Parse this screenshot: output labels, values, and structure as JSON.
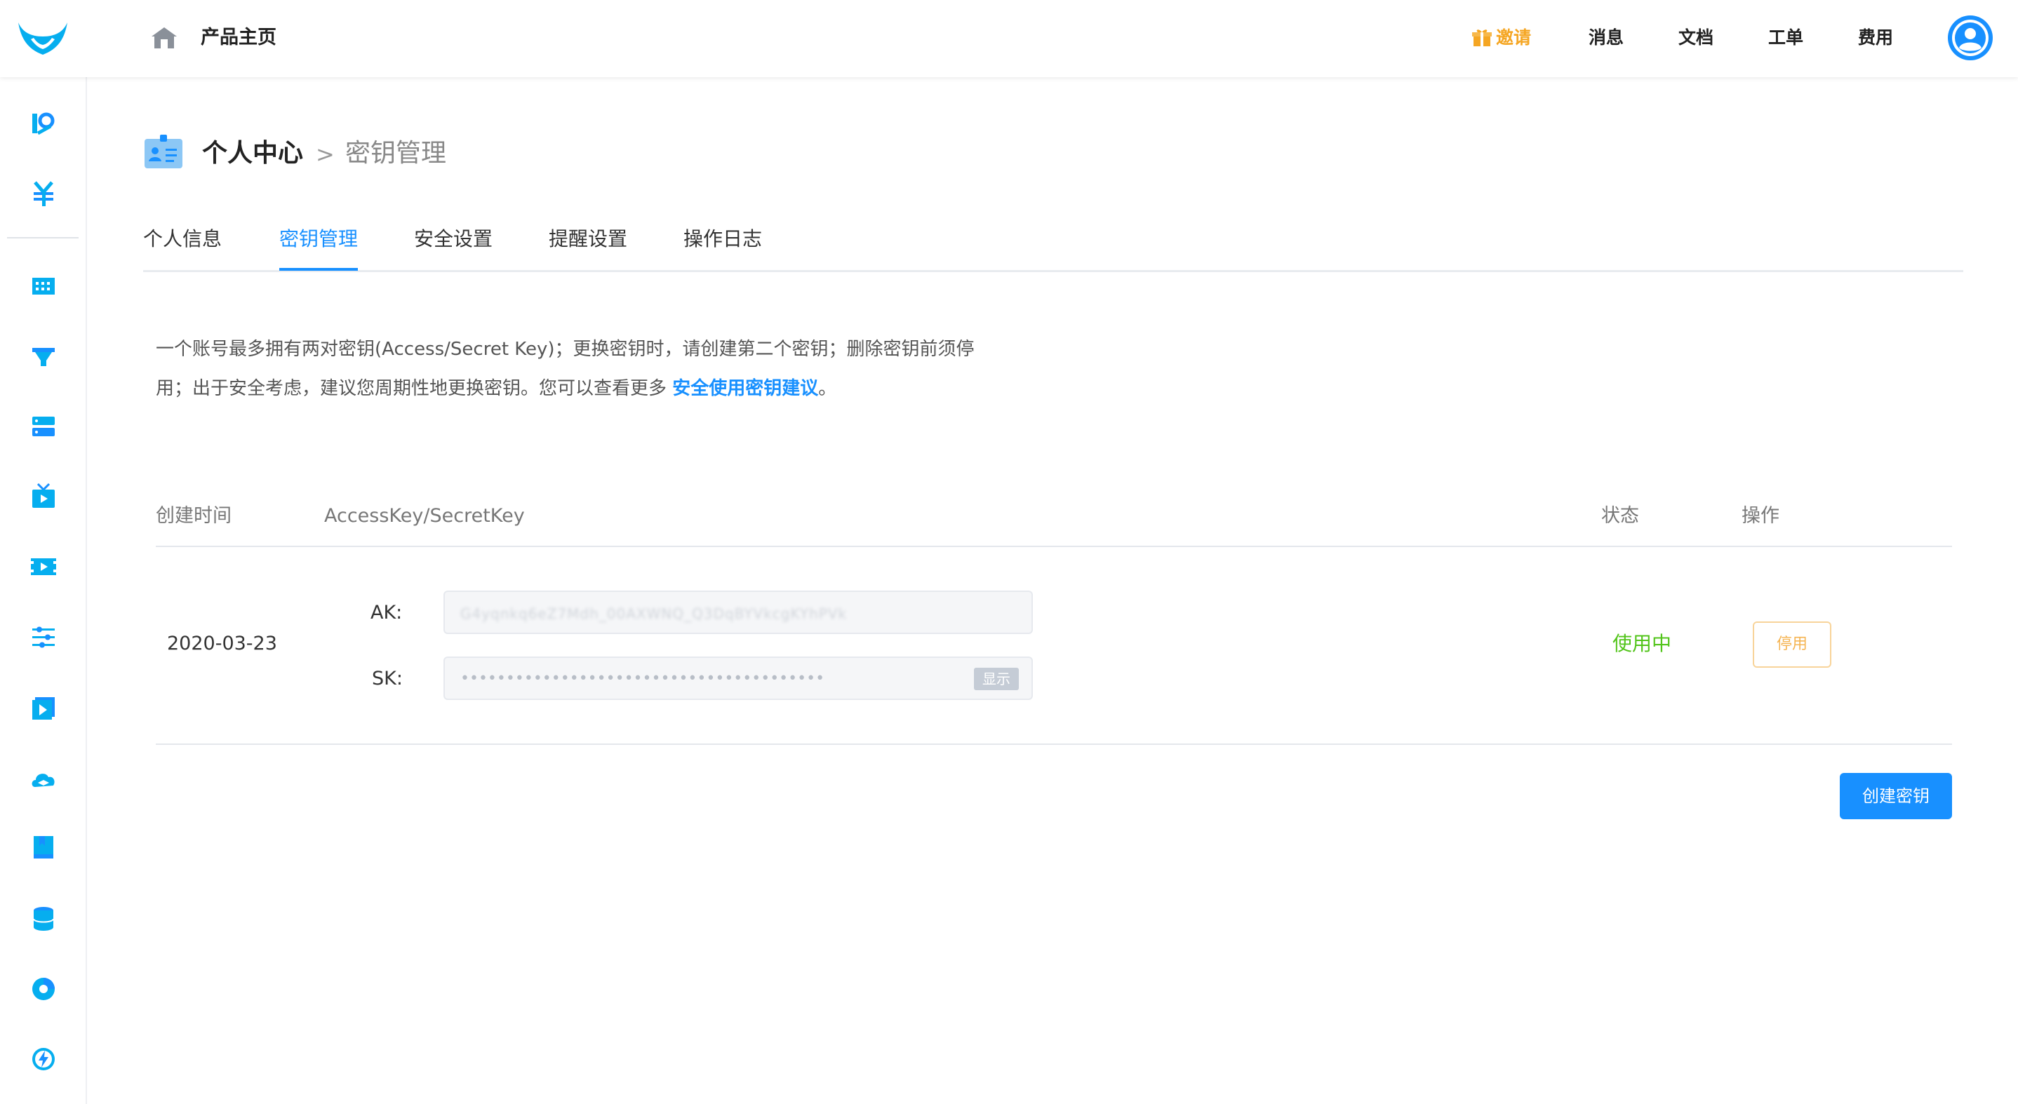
{
  "topbar": {
    "product_home": "产品主页",
    "nav": [
      {
        "label": "邀请",
        "icon": "gift-icon",
        "color": "#f5a623"
      },
      {
        "label": "消息"
      },
      {
        "label": "文档"
      },
      {
        "label": "工单"
      },
      {
        "label": "费用"
      }
    ]
  },
  "sidebar": {
    "icons": [
      "ai-icon",
      "yuan-icon",
      "dashboard-icon",
      "funnel-icon",
      "server-icon",
      "tv-icon",
      "video-icon",
      "sliders-icon",
      "play-icon",
      "cloud-icon",
      "book-icon",
      "database-icon",
      "chart-icon",
      "lightning-icon"
    ]
  },
  "header": {
    "title": "个人中心",
    "separator": ">",
    "subtitle": "密钥管理"
  },
  "tabs": [
    {
      "label": "个人信息",
      "active": false
    },
    {
      "label": "密钥管理",
      "active": true
    },
    {
      "label": "安全设置",
      "active": false
    },
    {
      "label": "提醒设置",
      "active": false
    },
    {
      "label": "操作日志",
      "active": false
    }
  ],
  "notice": {
    "line1": "一个账号最多拥有两对密钥(Access/Secret Key)；更换密钥时，请创建第二个密钥；删除密钥前须停",
    "line2_prefix": "用；出于安全考虑，建议您周期性地更换密钥。您可以查看更多 ",
    "link": "安全使用密钥建议",
    "line2_suffix": "。"
  },
  "table": {
    "headers": {
      "created": "创建时间",
      "key": "AccessKey/SecretKey",
      "status": "状态",
      "action": "操作"
    },
    "rows": [
      {
        "created": "2020-03-23",
        "ak_label": "AK:",
        "ak_value": "G4yqnkq6eZ7Mdh_00AXWNQ_Q3DqBYVkcgKYhPVk",
        "sk_label": "SK:",
        "sk_value": "••••••••••••••••••••••••••••••••••••••••",
        "show_label": "显示",
        "status": "使用中",
        "action_label": "停用"
      }
    ]
  },
  "create_button": "创建密钥",
  "colors": {
    "accent": "#1890ff",
    "success": "#52c41a",
    "warning": "#f5a623"
  }
}
